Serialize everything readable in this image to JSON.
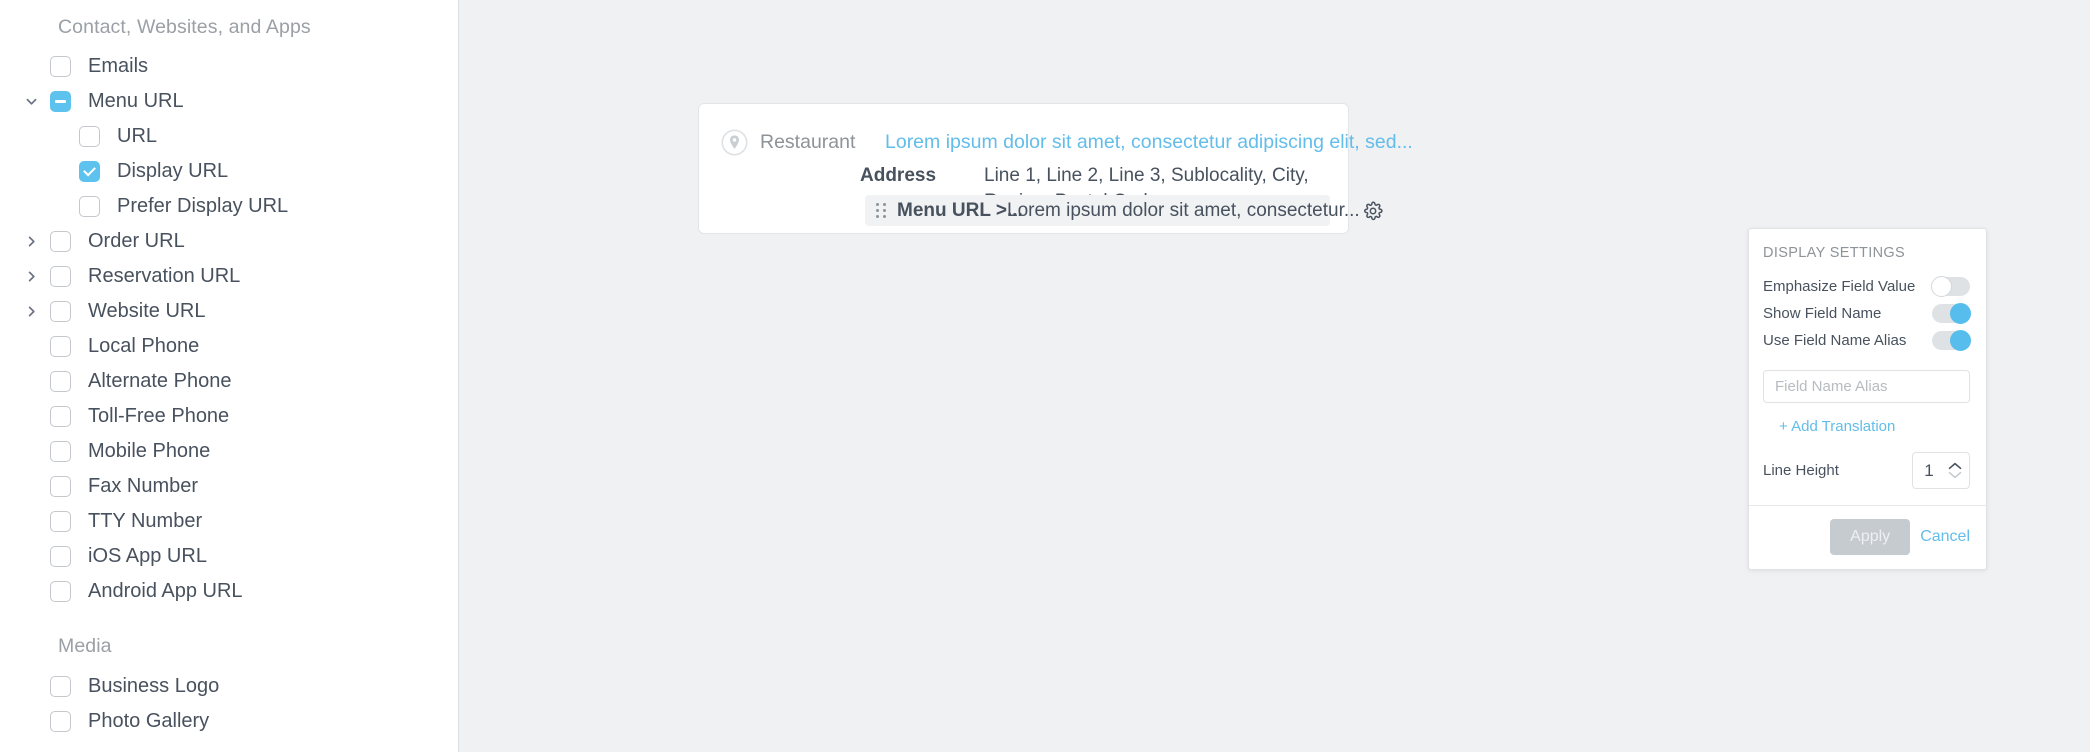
{
  "sidebar": {
    "groups": [
      {
        "title": "Contact, Websites, and Apps",
        "items": [
          {
            "label": "Emails",
            "indent": 1,
            "caret": "none",
            "check": "off"
          },
          {
            "label": "Menu URL",
            "indent": 1,
            "caret": "down",
            "check": "indeterminate"
          },
          {
            "label": "URL",
            "indent": 2,
            "caret": "none",
            "check": "off"
          },
          {
            "label": "Display URL",
            "indent": 2,
            "caret": "none",
            "check": "on"
          },
          {
            "label": "Prefer Display URL",
            "indent": 2,
            "caret": "none",
            "check": "off"
          },
          {
            "label": "Order URL",
            "indent": 1,
            "caret": "right",
            "check": "off"
          },
          {
            "label": "Reservation URL",
            "indent": 1,
            "caret": "right",
            "check": "off"
          },
          {
            "label": "Website URL",
            "indent": 1,
            "caret": "right",
            "check": "off"
          },
          {
            "label": "Local Phone",
            "indent": 1,
            "caret": "none",
            "check": "off"
          },
          {
            "label": "Alternate Phone",
            "indent": 1,
            "caret": "none",
            "check": "off"
          },
          {
            "label": "Toll-Free Phone",
            "indent": 1,
            "caret": "none",
            "check": "off"
          },
          {
            "label": "Mobile Phone",
            "indent": 1,
            "caret": "none",
            "check": "off"
          },
          {
            "label": "Fax Number",
            "indent": 1,
            "caret": "none",
            "check": "off"
          },
          {
            "label": "TTY Number",
            "indent": 1,
            "caret": "none",
            "check": "off"
          },
          {
            "label": "iOS App URL",
            "indent": 1,
            "caret": "none",
            "check": "off"
          },
          {
            "label": "Android App URL",
            "indent": 1,
            "caret": "none",
            "check": "off"
          }
        ]
      },
      {
        "title": "Media",
        "items": [
          {
            "label": "Business Logo",
            "indent": 1,
            "caret": "none",
            "check": "off"
          },
          {
            "label": "Photo Gallery",
            "indent": 1,
            "caret": "none",
            "check": "off"
          }
        ]
      }
    ]
  },
  "card": {
    "entity_icon": "map-pin-icon",
    "entity_type": "Restaurant",
    "entity_name": "Lorem ipsum dolor sit amet, consectetur adipiscing elit, sed...",
    "rows": [
      {
        "name": "Address",
        "value": "Line 1, Line 2, Line 3, Sublocality, City, Region, Postal Code"
      }
    ],
    "selected_row": {
      "name": "Menu URL >...",
      "value": "Lorem ipsum dolor sit amet, consectetur...",
      "gear_icon": "gear-icon",
      "drag_icon": "drag-handle-icon"
    }
  },
  "popover": {
    "title": "DISPLAY SETTINGS",
    "toggles": [
      {
        "label": "Emphasize Field Value",
        "state": "off"
      },
      {
        "label": "Show Field Name",
        "state": "on"
      },
      {
        "label": "Use Field Name Alias",
        "state": "on"
      }
    ],
    "alias_input": {
      "value": "",
      "placeholder": "Field Name Alias"
    },
    "add_translation_label": "+ Add Translation",
    "line_height": {
      "label": "Line Height",
      "value": "1"
    },
    "apply_label": "Apply",
    "cancel_label": "Cancel"
  },
  "colors": {
    "accent_blue": "#5ec2ef",
    "link_blue": "#62bdea",
    "text_dark": "#48525e",
    "text_muted": "#8d9399",
    "canvas_bg": "#f0f1f3",
    "card_bg": "#ffffff",
    "row_highlight": "#f1f2f4",
    "apply_disabled": "#c6cbd0"
  }
}
